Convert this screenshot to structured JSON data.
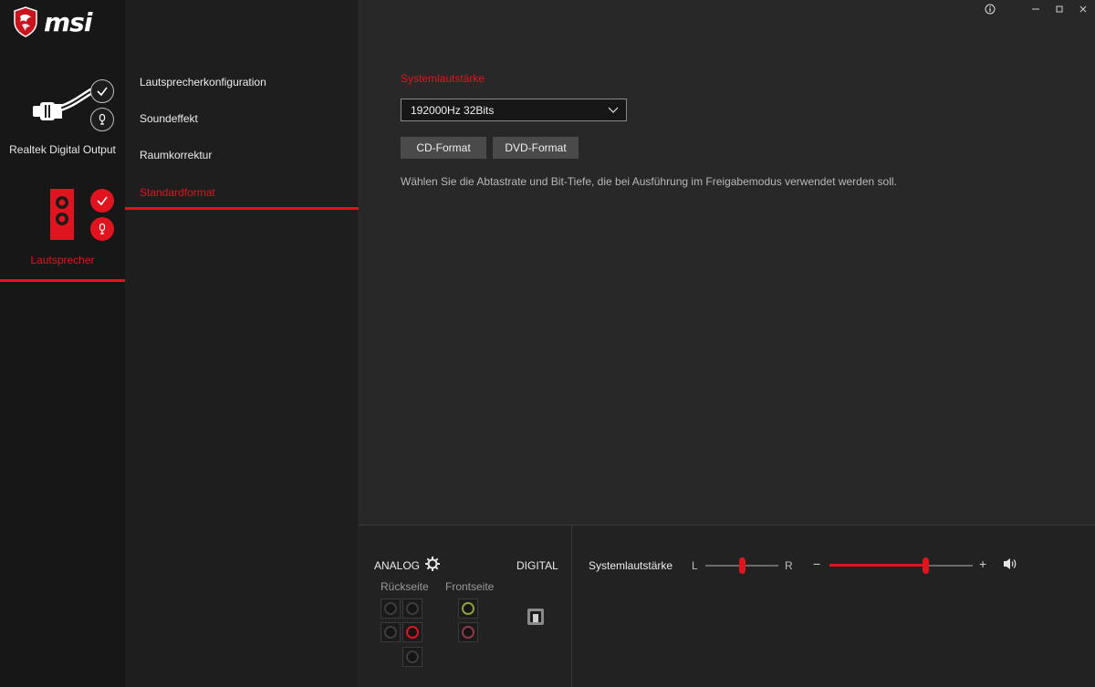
{
  "brand": {
    "logo_text": "msi"
  },
  "devices": [
    {
      "label": "Realtek Digital Output",
      "icon": "spdif-plug-icon",
      "selected": false
    },
    {
      "label": "Lautsprecher",
      "icon": "speaker-jack-icon",
      "selected": true
    }
  ],
  "menu": {
    "items": [
      {
        "label": "Lautsprecherkonfiguration",
        "active": false
      },
      {
        "label": "Soundeffekt",
        "active": false
      },
      {
        "label": "Raumkorrektur",
        "active": false
      },
      {
        "label": "Standardformat",
        "active": true
      }
    ]
  },
  "window": {
    "controls": [
      "info-icon",
      "minimize-icon",
      "maximize-icon",
      "close-icon"
    ]
  },
  "content": {
    "section_title": "Systemlautstärke",
    "format_select": {
      "value": "192000Hz 32Bits"
    },
    "buttons": {
      "cd": "CD-Format",
      "dvd": "DVD-Format"
    },
    "description": "Wählen Sie die Abtastrate und Bit-Tiefe, die bei Ausführung im Freigabemodus verwendet werden soll."
  },
  "jacks": {
    "analog_label": "ANALOG",
    "digital_label": "DIGITAL",
    "rear_label": "Rückseite",
    "front_label": "Frontseite"
  },
  "volume": {
    "label": "Systemlautstärke",
    "balance_left": "L",
    "balance_right": "R",
    "balance_fraction": 0.5,
    "level_fraction": 0.67,
    "minus": "−",
    "plus": "+"
  },
  "colors": {
    "accent": "#e0141e",
    "background": "#282828",
    "panel": "#1e1e1e"
  }
}
